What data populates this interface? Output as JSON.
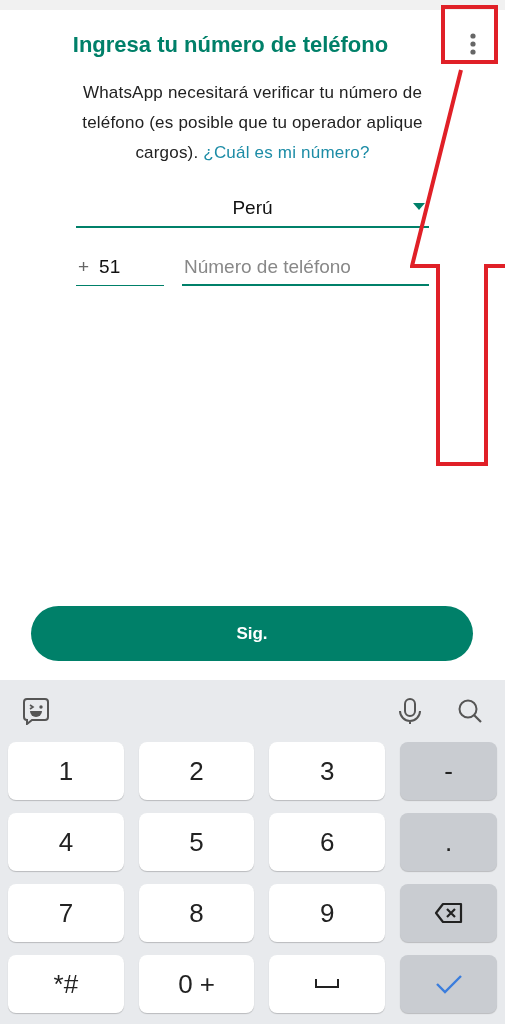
{
  "header": {
    "title": "Ingresa tu número de teléfono"
  },
  "intro": {
    "text": "WhatsApp necesitará verificar tu número de teléfono (es posible que tu operador aplique cargos).",
    "link": "¿Cuál es mi número?"
  },
  "country": {
    "value": "Perú"
  },
  "phone": {
    "prefix": "+",
    "code": "51",
    "placeholder": "Número de teléfono"
  },
  "next_button": {
    "label": "Sig."
  },
  "keyboard": {
    "rows": [
      [
        {
          "kind": "digit",
          "label": "1"
        },
        {
          "kind": "digit",
          "label": "2"
        },
        {
          "kind": "digit",
          "label": "3"
        },
        {
          "kind": "symbol",
          "label": "-"
        }
      ],
      [
        {
          "kind": "digit",
          "label": "4"
        },
        {
          "kind": "digit",
          "label": "5"
        },
        {
          "kind": "digit",
          "label": "6"
        },
        {
          "kind": "symbol",
          "label": "."
        }
      ],
      [
        {
          "kind": "digit",
          "label": "7"
        },
        {
          "kind": "digit",
          "label": "8"
        },
        {
          "kind": "digit",
          "label": "9"
        },
        {
          "kind": "backspace"
        }
      ],
      [
        {
          "kind": "digit",
          "label": "*#"
        },
        {
          "kind": "digit",
          "label": "0 +"
        },
        {
          "kind": "space"
        },
        {
          "kind": "done"
        }
      ]
    ]
  }
}
